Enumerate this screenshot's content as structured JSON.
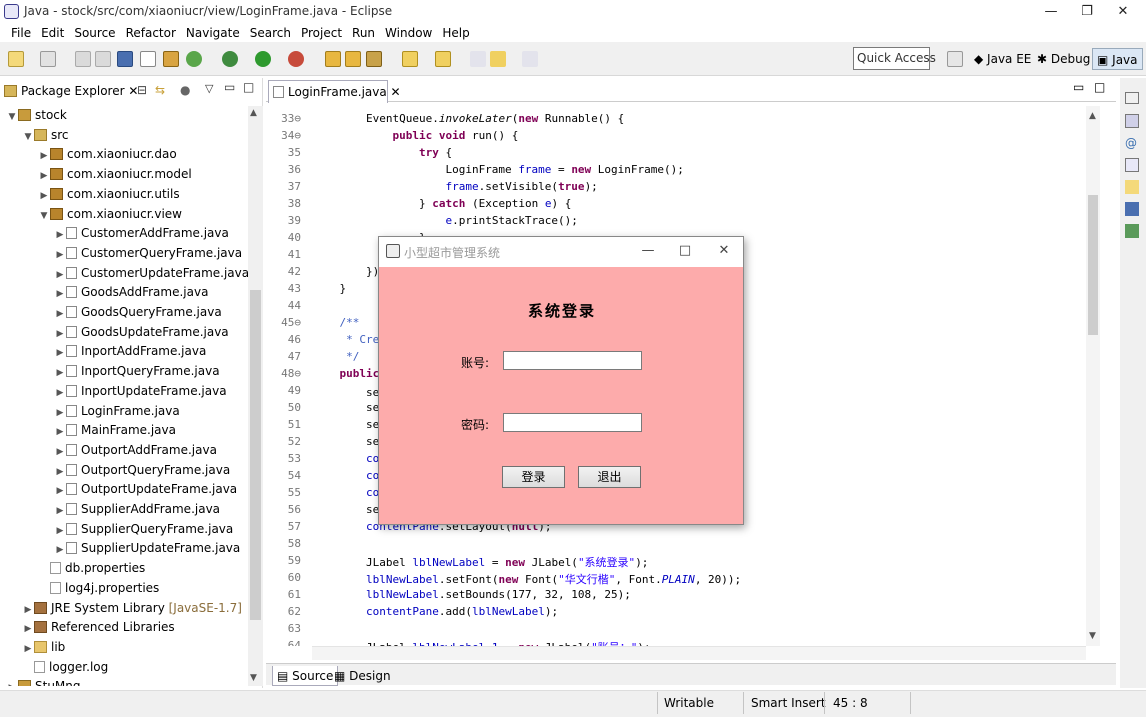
{
  "window": {
    "title": "Java - stock/src/com/xiaoniucr/view/LoginFrame.java - Eclipse",
    "minimize": "—",
    "maximize": "❐",
    "close": "✕"
  },
  "menu": [
    "File",
    "Edit",
    "Source",
    "Refactor",
    "Navigate",
    "Search",
    "Project",
    "Run",
    "Window",
    "Help"
  ],
  "toolbar": {
    "quick_access": "Quick Access",
    "perspectives": [
      "Java EE",
      "Debug",
      "Java"
    ]
  },
  "package_explorer": {
    "title": "Package Explorer",
    "items": [
      {
        "label": "stock",
        "depth": 0,
        "twisty": "v",
        "icon": "proj"
      },
      {
        "label": "src",
        "depth": 1,
        "twisty": "v",
        "icon": "src"
      },
      {
        "label": "com.xiaoniucr.dao",
        "depth": 2,
        "twisty": ">",
        "icon": "pkg"
      },
      {
        "label": "com.xiaoniucr.model",
        "depth": 2,
        "twisty": ">",
        "icon": "pkg"
      },
      {
        "label": "com.xiaoniucr.utils",
        "depth": 2,
        "twisty": ">",
        "icon": "pkg"
      },
      {
        "label": "com.xiaoniucr.view",
        "depth": 2,
        "twisty": "v",
        "icon": "pkg"
      },
      {
        "label": "CustomerAddFrame.java",
        "depth": 3,
        "twisty": ">",
        "icon": "java"
      },
      {
        "label": "CustomerQueryFrame.java",
        "depth": 3,
        "twisty": ">",
        "icon": "java"
      },
      {
        "label": "CustomerUpdateFrame.java",
        "depth": 3,
        "twisty": ">",
        "icon": "java"
      },
      {
        "label": "GoodsAddFrame.java",
        "depth": 3,
        "twisty": ">",
        "icon": "java"
      },
      {
        "label": "GoodsQueryFrame.java",
        "depth": 3,
        "twisty": ">",
        "icon": "java"
      },
      {
        "label": "GoodsUpdateFrame.java",
        "depth": 3,
        "twisty": ">",
        "icon": "java"
      },
      {
        "label": "InportAddFrame.java",
        "depth": 3,
        "twisty": ">",
        "icon": "java"
      },
      {
        "label": "InportQueryFrame.java",
        "depth": 3,
        "twisty": ">",
        "icon": "java"
      },
      {
        "label": "InportUpdateFrame.java",
        "depth": 3,
        "twisty": ">",
        "icon": "java"
      },
      {
        "label": "LoginFrame.java",
        "depth": 3,
        "twisty": ">",
        "icon": "java"
      },
      {
        "label": "MainFrame.java",
        "depth": 3,
        "twisty": ">",
        "icon": "java"
      },
      {
        "label": "OutportAddFrame.java",
        "depth": 3,
        "twisty": ">",
        "icon": "java"
      },
      {
        "label": "OutportQueryFrame.java",
        "depth": 3,
        "twisty": ">",
        "icon": "java"
      },
      {
        "label": "OutportUpdateFrame.java",
        "depth": 3,
        "twisty": ">",
        "icon": "java"
      },
      {
        "label": "SupplierAddFrame.java",
        "depth": 3,
        "twisty": ">",
        "icon": "java"
      },
      {
        "label": "SupplierQueryFrame.java",
        "depth": 3,
        "twisty": ">",
        "icon": "java"
      },
      {
        "label": "SupplierUpdateFrame.java",
        "depth": 3,
        "twisty": ">",
        "icon": "java"
      },
      {
        "label": "db.properties",
        "depth": 2,
        "twisty": "",
        "icon": "file"
      },
      {
        "label": "log4j.properties",
        "depth": 2,
        "twisty": "",
        "icon": "file"
      },
      {
        "label": "JRE System Library",
        "suffix": " [JavaSE-1.7]",
        "depth": 1,
        "twisty": ">",
        "icon": "jar"
      },
      {
        "label": "Referenced Libraries",
        "depth": 1,
        "twisty": ">",
        "icon": "jar"
      },
      {
        "label": "lib",
        "depth": 1,
        "twisty": ">",
        "icon": "folder"
      },
      {
        "label": "logger.log",
        "depth": 1,
        "twisty": "",
        "icon": "file"
      },
      {
        "label": "StuMng",
        "depth": 0,
        "twisty": ">",
        "icon": "proj"
      }
    ]
  },
  "editor": {
    "tab": "LoginFrame.java",
    "bottom_tabs": [
      "Source",
      "Design"
    ],
    "lines": [
      {
        "n": "33⊖",
        "html": "        EventQueue.<i>invokeLater</i>(<span class='kw'>new</span> Runnable() {"
      },
      {
        "n": "34⊖",
        "html": "            <span class='kw'>public void</span> run() {"
      },
      {
        "n": "35",
        "html": "                <span class='kw'>try</span> {"
      },
      {
        "n": "36",
        "html": "                    LoginFrame <span class='fld'>frame</span> = <span class='kw'>new</span> LoginFrame();"
      },
      {
        "n": "37",
        "html": "                    <span class='fld'>frame</span>.setVisible(<span class='kw'>true</span>);"
      },
      {
        "n": "38",
        "html": "                } <span class='kw'>catch</span> (Exception <span class='fld'>e</span>) {"
      },
      {
        "n": "39",
        "html": "                    <span class='fld'>e</span>.printStackTrace();"
      },
      {
        "n": "40",
        "html": "                }"
      },
      {
        "n": "41",
        "html": "            }"
      },
      {
        "n": "42",
        "html": "        });"
      },
      {
        "n": "43",
        "html": "    }"
      },
      {
        "n": "44",
        "html": ""
      },
      {
        "n": "45⊖",
        "html": "    <span class='cmt'>/**</span>"
      },
      {
        "n": "46",
        "html": "<span class='cmt'>     * Create the frame.</span>"
      },
      {
        "n": "47",
        "html": "<span class='cmt'>     */</span>"
      },
      {
        "n": "48⊖",
        "html": "    <span class='kw'>public</span> LoginFrame() {"
      },
      {
        "n": "49",
        "html": "        setTitle(<span class='str'>\"小型超市管理系统\"</span>);"
      },
      {
        "n": "50",
        "html": "        setResizable(<span class='kw'>false</span>);"
      },
      {
        "n": "51",
        "html": "        setDefaultCloseOperation(JFrame.<span class='fld'><i>EXIT_ON_CLOSE</i></span>);"
      },
      {
        "n": "52",
        "html": "        setBounds(100, 100, 450, 300);"
      },
      {
        "n": "53",
        "html": "        <span class='fld'>contentPane</span> = <span class='kw'>new</span> JPanel();"
      },
      {
        "n": "54",
        "html": "        <span class='fld'>contentPane</span>.setBackground(<span class='kw'>new</span> Color(255, 175, 175));"
      },
      {
        "n": "55",
        "html": "        <span class='fld'>contentPane</span>.setBorder(<span class='kw'>new</span> EmptyBorder(5, 5, 5, 5));"
      },
      {
        "n": "56",
        "html": "        setContentPane(<span class='fld'>contentPane</span>);"
      },
      {
        "n": "57",
        "html": "        <span class='fld'>contentPane</span>.setLayout(<span class='kw'>null</span>);"
      },
      {
        "n": "58",
        "html": ""
      },
      {
        "n": "59",
        "html": "        JLabel <span class='fld'>lblNewLabel</span> = <span class='kw'>new</span> JLabel(<span class='str'>\"系统登录\"</span>);"
      },
      {
        "n": "60",
        "html": "        <span class='fld'>lblNewLabel</span>.setFont(<span class='kw'>new</span> Font(<span class='str'>\"华文行楷\"</span>, Font.<span class='fld'><i>PLAIN</i></span>, 20));"
      },
      {
        "n": "61",
        "html": "        <span class='fld'>lblNewLabel</span>.setBounds(177, 32, 108, 25);"
      },
      {
        "n": "62",
        "html": "        <span class='fld'>contentPane</span>.add(<span class='fld'>lblNewLabel</span>);"
      },
      {
        "n": "63",
        "html": ""
      },
      {
        "n": "64",
        "html": "        JLabel <span class='fld'>lblNewLabel_1</span> = <span class='kw'>new</span> JLabel(<span class='str'>\"账号：\"</span>);"
      }
    ]
  },
  "status": {
    "writable": "Writable",
    "insert_mode": "Smart Insert",
    "position": "45 : 8"
  },
  "dialog": {
    "title": "小型超市管理系统",
    "heading": "系统登录",
    "account_label": "账号:",
    "password_label": "密码:",
    "login_button": "登录",
    "exit_button": "退出",
    "background": "#fdabab"
  }
}
